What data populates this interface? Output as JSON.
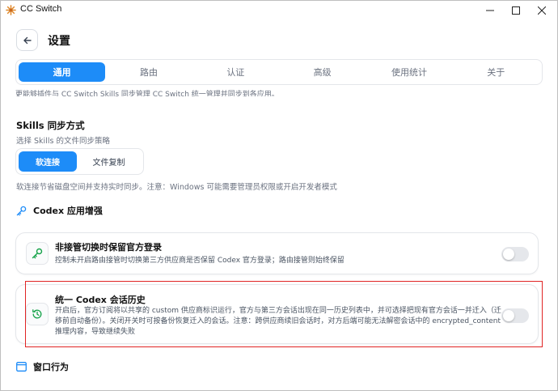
{
  "window": {
    "title": "CC Switch",
    "controls": [
      "minimize-icon",
      "maximize-icon",
      "close-icon"
    ]
  },
  "header": {
    "back_icon": "arrow-left-icon",
    "title": "设置"
  },
  "tabs": [
    {
      "label": "通用",
      "active": true
    },
    {
      "label": "路由",
      "active": false
    },
    {
      "label": "认证",
      "active": false
    },
    {
      "label": "高级",
      "active": false
    },
    {
      "label": "使用统计",
      "active": false
    },
    {
      "label": "关于",
      "active": false
    }
  ],
  "cut_text": "更能够插件与 CC Switch Skills 同步管理 CC Switch 统一管理并同步到各应用。",
  "skills_sync": {
    "title": "Skills 同步方式",
    "subtitle": "选择 Skills 的文件同步策略",
    "options": [
      {
        "label": "软连接",
        "active": true
      },
      {
        "label": "文件复制",
        "active": false
      }
    ],
    "hint": "软连接节省磁盘空间并支持实时同步。注意：Windows 可能需要管理员权限或开启开发者模式"
  },
  "codex_group": {
    "icon": "key-icon",
    "title": "Codex 应用增强"
  },
  "cards": [
    {
      "icon": "key-icon",
      "title": "非接管切换时保留官方登录",
      "description": "控制未开启路由接管时切换第三方供应商是否保留 Codex 官方登录；路由接管则始终保留",
      "enabled": false
    },
    {
      "icon": "history-icon",
      "title": "统一 Codex 会话历史",
      "description": "开启后，官方订阅将以共享的 custom 供应商标识运行，官方与第三方会话出现在同一历史列表中，并可选择把现有官方会话一并迁入（迁移前自动备份）。关闭开关时可按备份恢复迁入的会话。注意：跨供应商续旧会话时，对方后端可能无法解密会话中的 encrypted_content 推理内容，导致继续失败",
      "enabled": false
    }
  ],
  "window_group": {
    "icon": "window-icon",
    "title": "窗口行为"
  },
  "colors": {
    "accent": "#1d8cf8",
    "highlight_border": "#e02424",
    "toggle_off": "#e5e7eb"
  }
}
